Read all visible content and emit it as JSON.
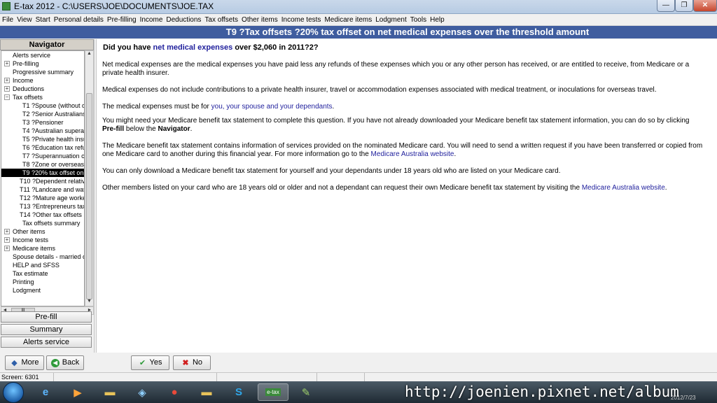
{
  "window": {
    "title": "E-tax 2012 - C:\\USERS\\JOE\\DOCUMENTS\\JOE.TAX",
    "min": "—",
    "max": "❐",
    "close": "✕"
  },
  "menu": [
    "File",
    "View",
    "Start",
    "Personal details",
    "Pre-filling",
    "Income",
    "Deductions",
    "Tax offsets",
    "Other items",
    "Income tests",
    "Medicare items",
    "Lodgment",
    "Tools",
    "Help"
  ],
  "header": {
    "title": "T9 ?Tax offsets ?20% tax offset on net medical expenses over the threshold amount"
  },
  "navigator": {
    "title": "Navigator",
    "items": [
      {
        "label": "Alerts service",
        "expander": ""
      },
      {
        "label": "Pre-filling",
        "expander": "+"
      },
      {
        "label": "Progressive summary",
        "expander": ""
      },
      {
        "label": "Income",
        "expander": "+"
      },
      {
        "label": "Deductions",
        "expander": "+"
      },
      {
        "label": "Tax offsets",
        "expander": "−"
      },
      {
        "label": "T1 ?Spouse (without dep",
        "expander": ""
      },
      {
        "label": "T2 ?Senior Australians",
        "expander": ""
      },
      {
        "label": "T3 ?Pensioner",
        "expander": ""
      },
      {
        "label": "T4 ?Australian superann",
        "expander": ""
      },
      {
        "label": "T5 ?Private health insura",
        "expander": ""
      },
      {
        "label": "T6 ?Education tax refund",
        "expander": ""
      },
      {
        "label": "T7 ?Superannuation cont",
        "expander": ""
      },
      {
        "label": "T8 ?Zone or overseas fo",
        "expander": ""
      },
      {
        "label": "T9 ?20% tax offset on ne",
        "expander": ""
      },
      {
        "label": "T10 ?Dependent relative",
        "expander": ""
      },
      {
        "label": "T11 ?Landcare and water",
        "expander": ""
      },
      {
        "label": "T12 ?Mature age worker -",
        "expander": ""
      },
      {
        "label": "T13 ?Entrepreneurs tax of",
        "expander": ""
      },
      {
        "label": "T14 ?Other tax offsets",
        "expander": ""
      },
      {
        "label": "Tax offsets summary",
        "expander": ""
      },
      {
        "label": "Other items",
        "expander": "+"
      },
      {
        "label": "Income tests",
        "expander": "+"
      },
      {
        "label": "Medicare items",
        "expander": "+"
      },
      {
        "label": "Spouse details - married or d",
        "expander": ""
      },
      {
        "label": "HELP and SFSS",
        "expander": ""
      },
      {
        "label": "Tax estimate",
        "expander": ""
      },
      {
        "label": "Printing",
        "expander": ""
      },
      {
        "label": "Lodgment",
        "expander": ""
      }
    ],
    "hscroll_thumb": "III",
    "buttons": {
      "prefill": "Pre-fill",
      "summary": "Summary",
      "alerts": "Alerts service"
    }
  },
  "content": {
    "question_prefix": "Did you have ",
    "question_link": "net medical expenses",
    "question_suffix": " over $2,060 in 2011?2?",
    "p1": "Net medical expenses are the medical expenses you have paid less any refunds of these expenses which you or any other person has received, or are entitled to receive, from Medicare or a private health insurer.",
    "p2": "Medical expenses do not include contributions to a private health insurer, travel or accommodation expenses associated with medical treatment, or inoculations for overseas travel.",
    "p3_prefix": "The medical expenses must be for ",
    "p3_link": "you, your spouse and your dependants",
    "p3_suffix": ".",
    "p4_prefix": "You might need your Medicare benefit tax statement to complete this question. If you have not already downloaded your Medicare benefit tax statement information, you can do so by clicking ",
    "p4_bold1": "Pre-fill",
    "p4_mid": " below the ",
    "p4_bold2": "Navigator",
    "p4_suffix": ".",
    "p5_prefix": "The Medicare benefit tax statement contains information of services provided on the nominated Medicare card. You will need to send a written request if you have been transferred or copied from one Medicare card to another during this financial year. For more information go to the ",
    "p5_link": "Medicare Australia website",
    "p5_suffix": ".",
    "p6": "You can only download a Medicare benefit tax statement for yourself and your dependants under 18 years old who are listed on your Medicare card.",
    "p7_prefix": "Other members listed on your card who are 18 years old or older and not a dependant can request their own Medicare benefit tax statement by visiting the ",
    "p7_link": "Medicare Australia website",
    "p7_suffix": "."
  },
  "buttons": {
    "more": "More",
    "back": "Back",
    "yes": "Yes",
    "no": "No"
  },
  "status": {
    "screen": "Screen: 6301"
  },
  "taskbar": {
    "items": [
      "start-orb",
      "ie-icon",
      "media-player-icon",
      "folder-icon",
      "network-icon",
      "chrome-icon",
      "folder-icon",
      "skype-icon",
      "etax-icon",
      "paint-icon"
    ],
    "etax_label": "e-tax",
    "date": "2012/7/23"
  },
  "watermark": "http://joenien.pixnet.net/album",
  "colors": {
    "header": "#3f5d9f",
    "link": "#1f1f9c",
    "selected": "#000000"
  }
}
